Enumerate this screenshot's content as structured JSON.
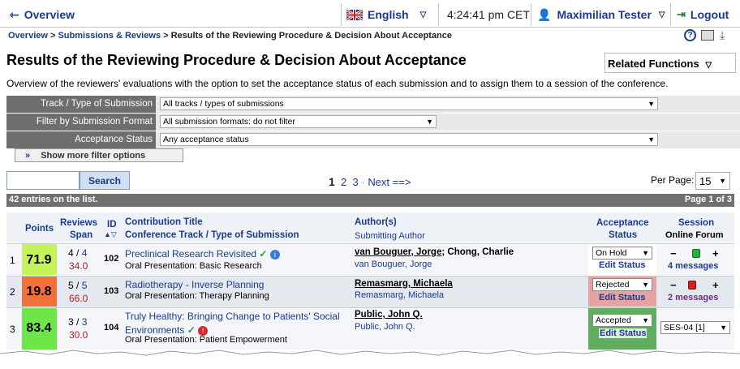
{
  "topbar": {
    "overview": "Overview",
    "language": "English",
    "time": "4:24:41 pm CET",
    "user": "Maximilian Tester",
    "logout": "Logout"
  },
  "breadcrumb": {
    "items": [
      "Overview",
      "Submissions & Reviews"
    ],
    "current": "Results of the Reviewing Procedure & Decision About Acceptance"
  },
  "page": {
    "title": "Results of the Reviewing Procedure & Decision About Acceptance",
    "related_functions": "Related Functions",
    "description": "Overview of the reviewers' evaluations with the option to set the acceptance status of each submission and to assign them to a session of the conference."
  },
  "filters": {
    "track_label": "Track / Type of Submission",
    "track_value": "All tracks / types of submissions",
    "format_label": "Filter by Submission Format",
    "format_value": "All submission formats: do not filter",
    "status_label": "Acceptance Status",
    "status_value": "Any acceptance status",
    "more_button": "Show more filter options"
  },
  "search": {
    "button": "Search",
    "value": ""
  },
  "pager": {
    "current": "1",
    "pages": [
      "2",
      "3"
    ],
    "next": "Next ==>",
    "per_page_label": "Per Page:",
    "per_page_value": "15"
  },
  "list": {
    "entries": "42 entries on the list.",
    "page_of": "Page 1 of 3"
  },
  "columns": {
    "points": "Points",
    "reviews": "Reviews",
    "span": "Span",
    "id": "ID",
    "title": "Contribution Title",
    "track": "Conference Track / Type of Submission",
    "authors": "Author(s)",
    "submitting": "Submitting Author",
    "acceptance": "Acceptance",
    "status": "Status",
    "session": "Session",
    "forum": "Online Forum"
  },
  "rows": [
    {
      "num": "1",
      "points": "71.9",
      "points_color": "#c6f25a",
      "reviews_done": "4",
      "reviews_total": "4",
      "span": "34.0",
      "id": "102",
      "title": "Preclinical Research Revisited",
      "track": "Oral Presentation: Basic Research",
      "authors_main": "van Bouguer, Jorge",
      "authors_rest": "; Chong, Charlie",
      "submitting": "van Bouguer, Jorge",
      "status": "On Hold",
      "status_bg": "#ffffff",
      "edit": "Edit Status",
      "forum": "4 messages",
      "session": ""
    },
    {
      "num": "2",
      "points": "19.8",
      "points_color": "#f2703a",
      "reviews_done": "5",
      "reviews_total": "5",
      "span": "66.0",
      "id": "103",
      "title": "Radiotherapy - Inverse Planning",
      "track": "Oral Presentation: Therapy Planning",
      "authors_main": "Remasmarg, Michaela",
      "authors_rest": "",
      "submitting": "Remasmarg, Michaela",
      "status": "Rejected",
      "status_bg": "#e7a3a3",
      "edit": "Edit Status",
      "forum": "2 messages",
      "session": ""
    },
    {
      "num": "3",
      "points": "83.4",
      "points_color": "#6ee64a",
      "reviews_done": "3",
      "reviews_total": "3",
      "span": "30.0",
      "id": "104",
      "title": "Truly Healthy: Bringing Change to Patients' Social Environments",
      "track": "Oral Presentation: Patient Empowerment",
      "authors_main": "Public, John Q.",
      "authors_rest": "",
      "submitting": "Public, John Q.",
      "status": "Accepted",
      "status_bg": "#5fae5f",
      "edit": "Edit Status",
      "forum": "",
      "session": "SES-04 [1]"
    }
  ]
}
